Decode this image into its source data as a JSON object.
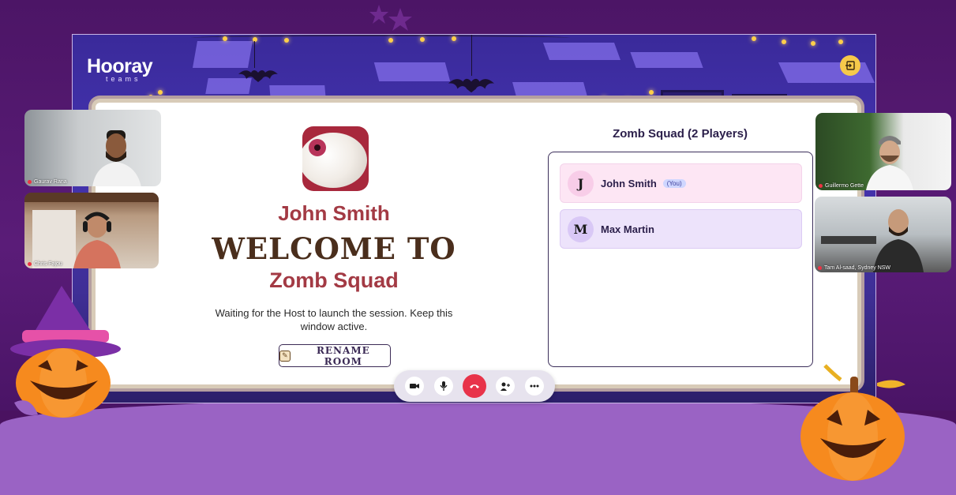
{
  "app": {
    "brand": "Hooray",
    "brand_sub": "teams"
  },
  "lobby": {
    "player_name": "John Smith",
    "welcome": "WELCOME TO",
    "game_title": "Zomb Squad",
    "waiting_message": "Waiting for the Host to launch the session. Keep this window active.",
    "rename_label": "RENAME ROOM"
  },
  "team": {
    "title": "Zomb Squad (2 Players)",
    "players": [
      {
        "initial": "J",
        "name": "John Smith",
        "badge": "(You)",
        "bg": "#fde6f4",
        "avatar": "#f8cde8"
      },
      {
        "initial": "M",
        "name": "Max Martin",
        "badge": "",
        "bg": "#ede3fb",
        "avatar": "#d9c8f6"
      }
    ]
  },
  "videos": [
    {
      "name": "Gaurav Rana"
    },
    {
      "name": "Chris Fajou"
    },
    {
      "name": "Guillermo Gette"
    },
    {
      "name": "Tam Al-saad, Sydney NSW"
    }
  ],
  "controls": [
    "camera-icon",
    "microphone-icon",
    "end-call-icon",
    "add-person-icon",
    "more-icon"
  ],
  "colors": {
    "accent": "#a33a44",
    "end_call": "#e8334a",
    "exit_button": "#f6c94a"
  }
}
